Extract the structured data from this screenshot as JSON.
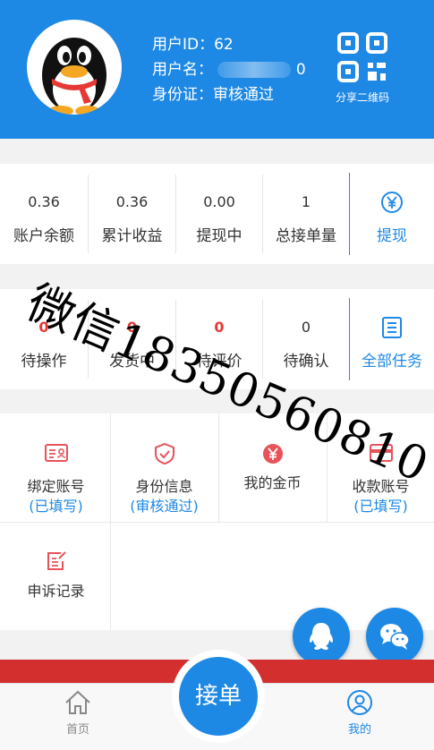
{
  "profile": {
    "user_id_label": "用户ID：",
    "user_id_value": "62",
    "username_label": "用户名：",
    "username_suffix": "0",
    "id_label": "身份证：",
    "id_status": "审核通过",
    "qr_label": "分享二维码"
  },
  "stats": [
    {
      "value": "0.36",
      "label": "账户余额"
    },
    {
      "value": "0.36",
      "label": "累计收益"
    },
    {
      "value": "0.00",
      "label": "提现中"
    },
    {
      "value": "1",
      "label": "总接单量"
    }
  ],
  "withdraw": {
    "label": "提现",
    "icon": "yen-circle-icon"
  },
  "orders": [
    {
      "value": "0",
      "label": "待操作"
    },
    {
      "value": "0",
      "label": "发货中"
    },
    {
      "value": "0",
      "label": "待评价"
    },
    {
      "value": "0",
      "label": "待确认"
    }
  ],
  "all_tasks": {
    "label": "全部任务",
    "icon": "list-icon"
  },
  "grid": [
    {
      "title": "绑定账号",
      "sub": "(已填写)",
      "icon": "id-card-icon"
    },
    {
      "title": "身份信息",
      "sub": "(审核通过)",
      "icon": "shield-check-icon"
    },
    {
      "title": "我的金币",
      "sub": "",
      "icon": "coin-icon"
    },
    {
      "title": "收款账号",
      "sub": "(已填写)",
      "icon": "card-icon"
    },
    {
      "title": "申诉记录",
      "sub": "",
      "icon": "edit-icon"
    }
  ],
  "watermark": "微信18350560810",
  "tabs": {
    "home": "首页",
    "center": "接单",
    "mine": "我的"
  },
  "colors": {
    "primary": "#1e88e5",
    "red": "#e53935",
    "icon_red": "#e8525a"
  }
}
